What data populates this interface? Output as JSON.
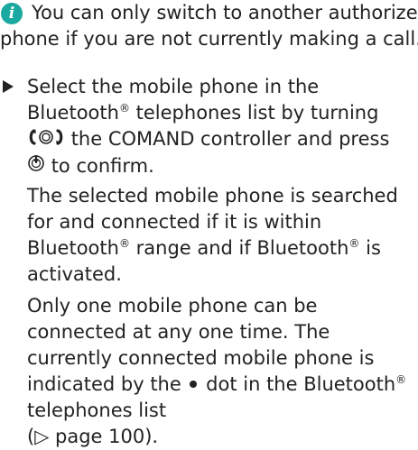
{
  "note": {
    "icon": "info-icon",
    "icon_glyph": "i",
    "icon_color": "#1aa9a0",
    "line1": "You can only switch to another authorized",
    "line2": "phone if you are not currently making a call."
  },
  "step": {
    "marker_icon": "step-triangle-icon",
    "para1": {
      "part1": "Select the mobile phone in the Bluetooth",
      "reg1": "®",
      "part2": "telephones list by turning",
      "part3": "the COMAND controller and press",
      "part4": "to confirm."
    },
    "para2": {
      "part1": "The selected mobile phone is searched for and connected if it is within Bluetooth",
      "reg1": "®",
      "part2": "range and if Bluetooth",
      "reg2": "®",
      "part3": "is activated."
    },
    "para3": {
      "part1": "Only one mobile phone can be connected at any one time. The currently connected mobile phone is indicated by the",
      "part2": "dot in the Bluetooth",
      "reg1": "®",
      "part3": "telephones list",
      "page_ref": "(▷ page 100)."
    }
  }
}
